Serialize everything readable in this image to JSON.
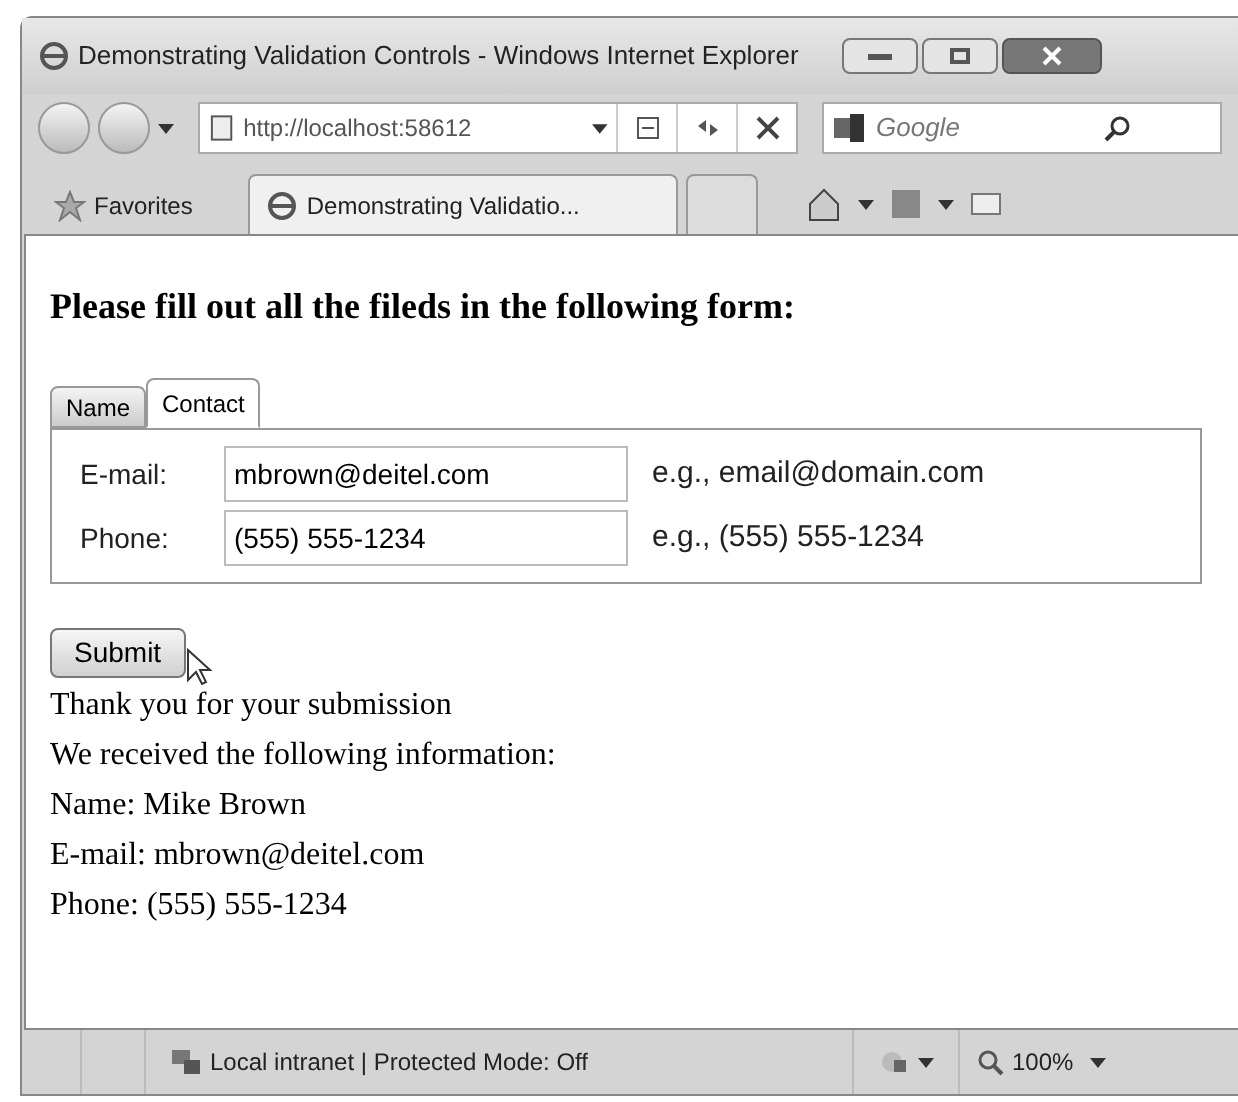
{
  "window": {
    "title": "Demonstrating Validation Controls - Windows Internet Explorer"
  },
  "address_bar": {
    "value": "http://localhost:58612"
  },
  "search": {
    "placeholder": "Google"
  },
  "favorites": "Favorites",
  "browser_tabs": [
    {
      "label": "Demonstrating Validatio...",
      "selected": true
    },
    {
      "selected": false
    }
  ],
  "page": {
    "heading": "Please fill out all the fileds in the following form:",
    "form_tabs": [
      {
        "label": "Name",
        "selected": false
      },
      {
        "label": "Contact",
        "selected": true
      }
    ],
    "fields": [
      {
        "label": "E-mail:",
        "value": "mbrown@deitel.com",
        "hint": "e.g., email@domain.com"
      },
      {
        "label": "Phone:",
        "value": "(555) 555-1234",
        "hint": "e.g., (555) 555-1234"
      }
    ],
    "submit": "Submit",
    "result_lines": [
      "Thank you for your submission",
      "We received the following information:",
      "Name: Mike Brown",
      "E-mail: mbrown@deitel.com",
      "Phone: (555) 555-1234"
    ]
  },
  "status_bar": {
    "zone": "Local intranet | Protected Mode: Off",
    "zoom": "100%"
  }
}
